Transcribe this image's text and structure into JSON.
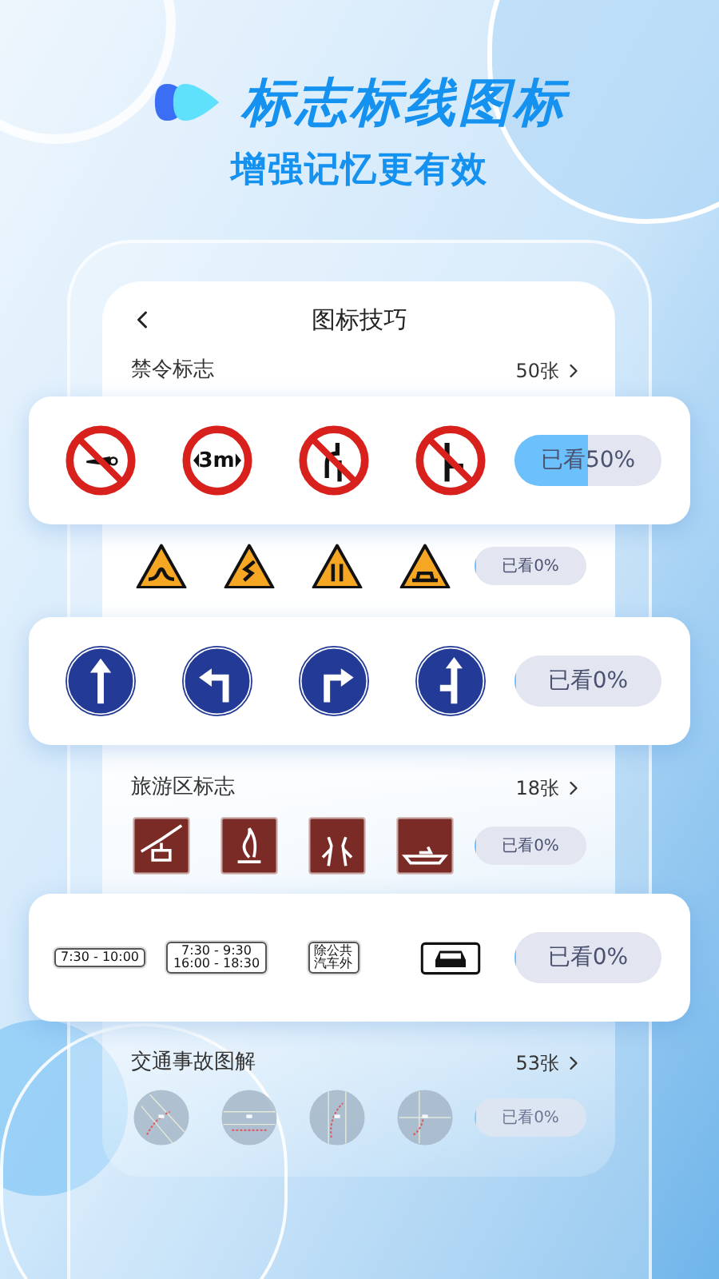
{
  "headline": {
    "title": "标志标线图标",
    "subtitle": "增强记忆更有效"
  },
  "screen": {
    "title": "图标技巧",
    "rows": [
      {
        "kind": "header",
        "label": "禁令标志",
        "count": "50张"
      },
      {
        "kind": "card",
        "signs": [
          {
            "kind": "prohibition"
          },
          {
            "kind": "prohibition",
            "text": "3m"
          },
          {
            "kind": "prohibition"
          },
          {
            "kind": "prohibition"
          }
        ],
        "progress": {
          "label": "已看50%",
          "level": 0.5
        }
      },
      {
        "kind": "compact",
        "signs": [
          {
            "kind": "warning"
          },
          {
            "kind": "warning"
          },
          {
            "kind": "warning"
          },
          {
            "kind": "warning"
          }
        ],
        "progress": {
          "label": "已看0%",
          "level": 0
        }
      },
      {
        "kind": "card",
        "signs": [
          {
            "kind": "direction"
          },
          {
            "kind": "direction"
          },
          {
            "kind": "direction"
          },
          {
            "kind": "direction"
          }
        ],
        "progress": {
          "label": "已看0%",
          "level": 0
        }
      },
      {
        "kind": "header",
        "label": "旅游区标志",
        "count": "18张"
      },
      {
        "kind": "compact",
        "signs": [
          {
            "kind": "tourist"
          },
          {
            "kind": "tourist"
          },
          {
            "kind": "tourist"
          },
          {
            "kind": "tourist"
          }
        ],
        "progress": {
          "label": "已看0%",
          "level": 0
        }
      },
      {
        "kind": "card",
        "signs": [
          {
            "kind": "plate",
            "lines": [
              "7:30 - 10:00"
            ]
          },
          {
            "kind": "plate",
            "lines": [
              "7:30 - 9:30",
              "16:00 - 18:30"
            ]
          },
          {
            "kind": "plate",
            "lines": [
              "除公共",
              "汽车外"
            ]
          },
          {
            "kind": "car-plate"
          }
        ],
        "progress": {
          "label": "已看0%",
          "level": 0
        }
      },
      {
        "kind": "header",
        "label": "交通事故图解",
        "count": "53张"
      },
      {
        "kind": "compact",
        "faded": true,
        "signs": [
          {
            "kind": "diagram"
          },
          {
            "kind": "diagram"
          },
          {
            "kind": "diagram"
          },
          {
            "kind": "diagram"
          }
        ],
        "progress": {
          "label": "已看0%",
          "level": 0
        }
      }
    ]
  }
}
